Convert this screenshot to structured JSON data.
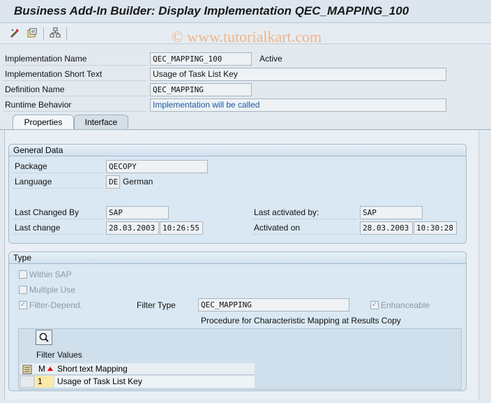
{
  "title": "Business Add-In Builder: Display Implementation QEC_MAPPING_100",
  "watermark": "© www.tutorialkart.com",
  "header_fields": {
    "impl_name_label": "Implementation Name",
    "impl_name_value": "QEC_MAPPING_100",
    "impl_status": "Active",
    "short_text_label": "Implementation Short Text",
    "short_text_value": "Usage of Task List Key",
    "def_name_label": "Definition Name",
    "def_name_value": "QEC_MAPPING",
    "runtime_label": "Runtime Behavior",
    "runtime_value": "Implementation will be called"
  },
  "tabs": {
    "properties": "Properties",
    "interface": "Interface"
  },
  "general": {
    "title": "General Data",
    "package_label": "Package",
    "package_value": "QECOPY",
    "language_label": "Language",
    "language_code": "DE",
    "language_name": "German",
    "last_changed_by_label": "Last Changed By",
    "last_changed_by_value": "SAP",
    "last_change_label": "Last change",
    "last_change_date": "28.03.2003",
    "last_change_time": "10:26:55",
    "last_activated_by_label": "Last activated by:",
    "last_activated_by_value": "SAP",
    "activated_on_label": "Activated on",
    "activated_on_date": "28.03.2003",
    "activated_on_time": "10:30:28"
  },
  "type": {
    "title": "Type",
    "within_sap": "Within SAP",
    "multiple_use": "Multiple Use",
    "filter_depend": "Filter-Depend.",
    "filter_type_label": "Filter Type",
    "filter_type_value": "QEC_MAPPING",
    "enhanceable": "Enhanceable",
    "filter_desc": "Procedure for Characteristic Mapping at Results Copy",
    "filter_values_label": "Filter Values",
    "col_m": "M",
    "col_short_text": "Short text Mapping",
    "row1_m": "1",
    "row1_text": "Usage of Task List Key"
  }
}
